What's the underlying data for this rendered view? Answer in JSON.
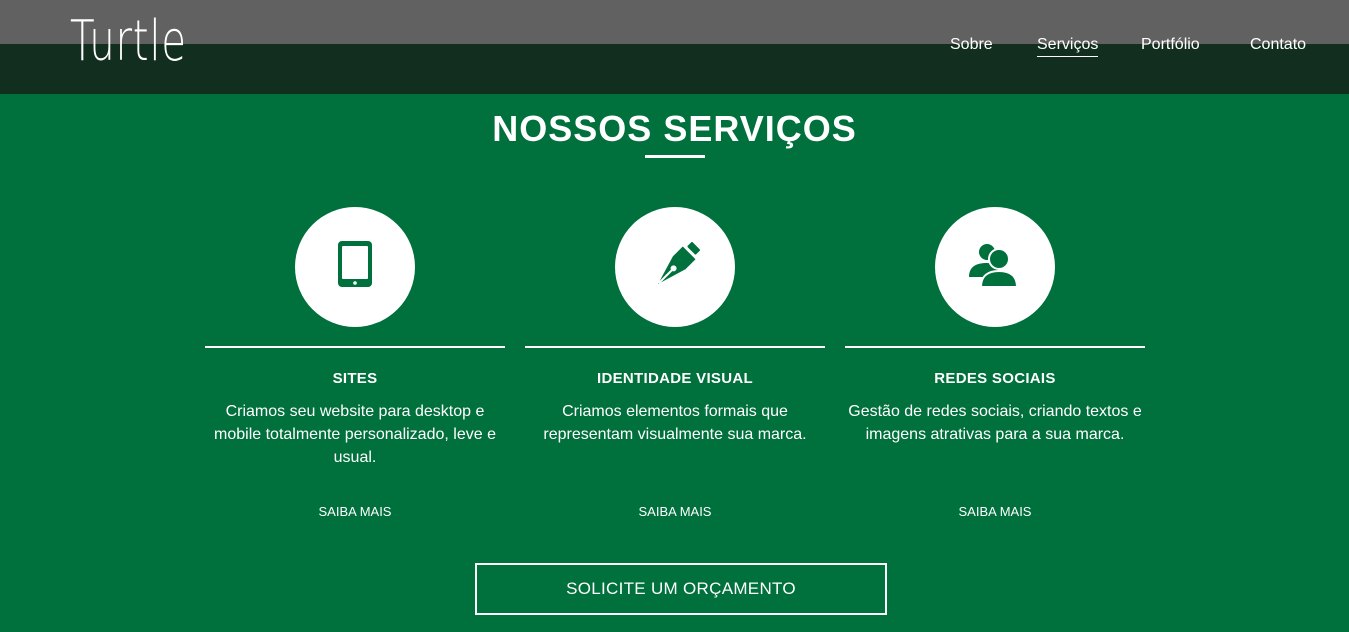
{
  "brand": {
    "logo": "Turtle"
  },
  "nav": {
    "items": [
      {
        "label": "Sobre"
      },
      {
        "label": "Serviços",
        "active": true
      },
      {
        "label": "Portfólio"
      },
      {
        "label": "Contato"
      }
    ]
  },
  "services_section": {
    "title": "NOSSOS SERVIÇOS",
    "services": [
      {
        "icon": "tablet-icon",
        "title": "SITES",
        "description": "Criamos seu website para desktop e mobile totalmente personalizado, leve e usual.",
        "link": "SAIBA MAIS"
      },
      {
        "icon": "pen-nib-icon",
        "title": "IDENTIDADE VISUAL",
        "description": "Criamos elementos formais que representam visualmente sua marca.",
        "link": "SAIBA MAIS"
      },
      {
        "icon": "users-icon",
        "title": "REDES SOCIAIS",
        "description": "Gestão de redes sociais, criando textos e imagens atrativas para a sua marca.",
        "link": "SAIBA MAIS"
      }
    ],
    "cta": "SOLICITE UM ORÇAMENTO"
  },
  "colors": {
    "page_background": "#00703c",
    "header_background": "#122e1f",
    "top_strip": "#616161",
    "text": "#ffffff",
    "icon": "#00703c"
  }
}
